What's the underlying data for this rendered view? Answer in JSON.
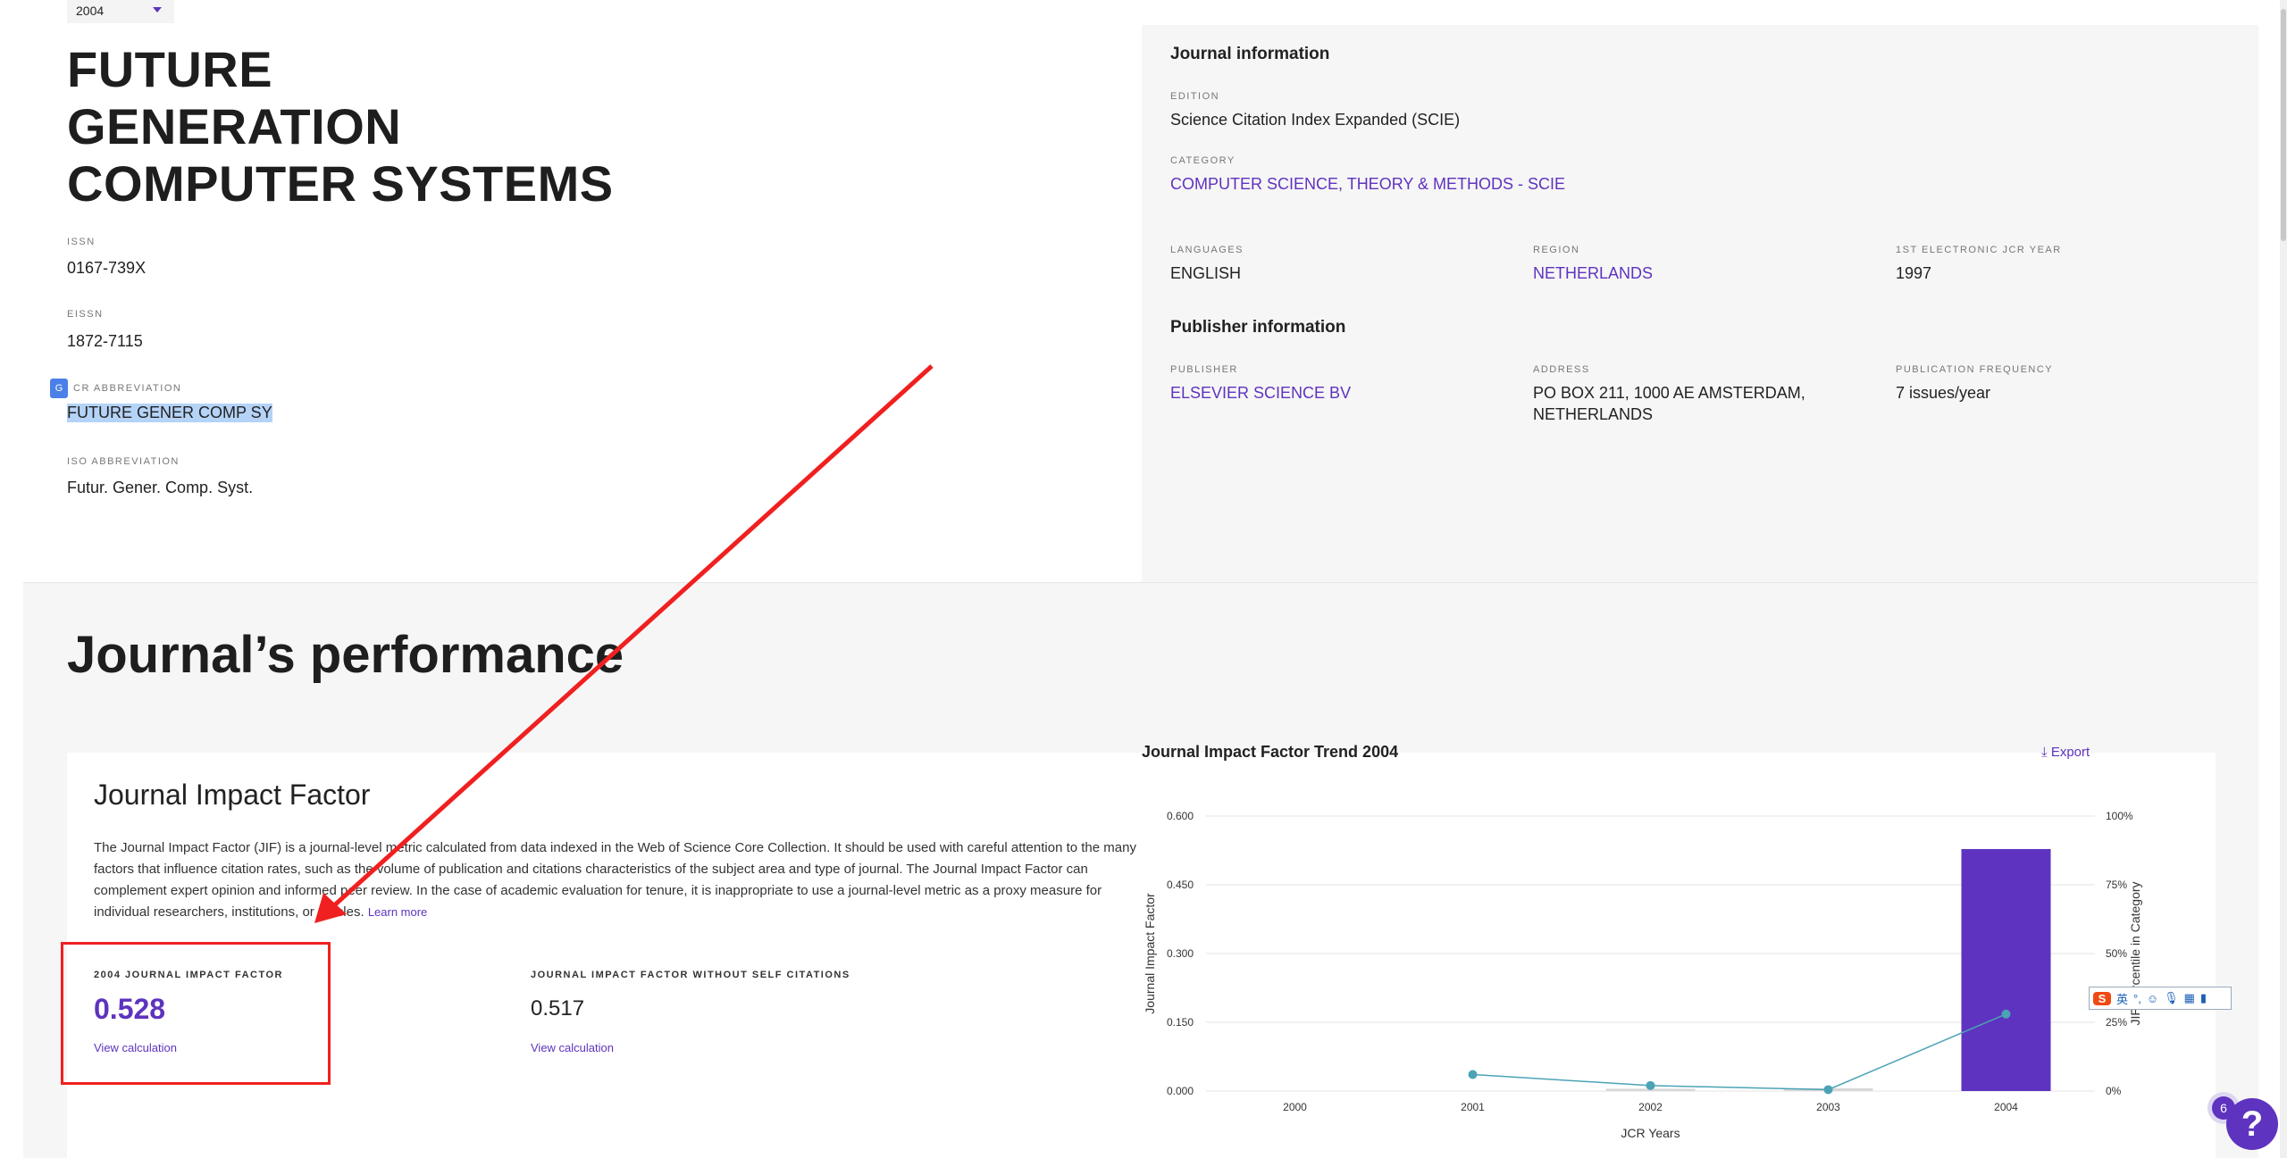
{
  "year_select": {
    "value": "2004"
  },
  "journal": {
    "title_lines": [
      "FUTURE",
      "GENERATION",
      "COMPUTER SYSTEMS"
    ],
    "issn_label": "ISSN",
    "issn": "0167-739X",
    "eissn_label": "EISSN",
    "eissn": "1872-7115",
    "jcr_abbrev_label": "CR ABBREVIATION",
    "jcr_abbrev": "FUTURE GENER COMP SY",
    "iso_abbrev_label": "ISO ABBREVIATION",
    "iso_abbrev": "Futur. Gener. Comp. Syst."
  },
  "journal_info": {
    "heading": "Journal information",
    "edition_label": "EDITION",
    "edition": "Science Citation Index Expanded (SCIE)",
    "category_label": "CATEGORY",
    "category": "COMPUTER SCIENCE, THEORY & METHODS - SCIE",
    "languages_label": "LANGUAGES",
    "languages": "ENGLISH",
    "region_label": "REGION",
    "region": "NETHERLANDS",
    "first_year_label": "1ST ELECTRONIC JCR YEAR",
    "first_year": "1997"
  },
  "publisher_info": {
    "heading": "Publisher information",
    "publisher_label": "PUBLISHER",
    "publisher": "ELSEVIER SCIENCE BV",
    "address_label": "ADDRESS",
    "address_line1": "PO BOX 211, 1000 AE AMSTERDAM,",
    "address_line2": "NETHERLANDS",
    "frequency_label": "PUBLICATION FREQUENCY",
    "frequency": "7 issues/year"
  },
  "performance": {
    "heading": "Journal’s performance",
    "jif_heading": "Journal Impact Factor",
    "description": "The Journal Impact Factor (JIF) is a journal-level metric calculated from data indexed in the Web of Science Core Collection. It should be used with careful attention to the many factors that influence citation rates, such as the volume of publication and citations characteristics of the subject area and type of journal. The Journal Impact Factor can complement expert opinion and informed peer review. In the case of academic evaluation for tenure, it is inappropriate to use a journal-level metric as a proxy measure for individual researchers, institutions, or articles.",
    "learn_more": "Learn more",
    "jif_label": "2004 JOURNAL IMPACT FACTOR",
    "jif_value": "0.528",
    "jif_noself_label": "JOURNAL IMPACT FACTOR WITHOUT SELF CITATIONS",
    "jif_noself_value": "0.517",
    "view_calc": "View calculation",
    "export": "Export"
  },
  "chart_data": {
    "type": "bar",
    "title": "Journal Impact Factor Trend 2004",
    "xlabel": "JCR Years",
    "ylabel": "Journal Impact Factor",
    "ylabel_right": "JIF Percentile in Category",
    "categories": [
      "2000",
      "2001",
      "2002",
      "2003",
      "2004"
    ],
    "ylim": [
      0,
      0.6
    ],
    "yticks": [
      "0.000",
      "0.150",
      "0.300",
      "0.450",
      "0.600"
    ],
    "yticks_right": [
      "0%",
      "25%",
      "50%",
      "75%",
      "100%"
    ],
    "series": [
      {
        "type": "bar",
        "values": [
          null,
          null,
          0.005,
          0.006,
          0.528
        ],
        "colors": [
          "#d8d8d8",
          "#d8d8d8",
          "#d8d8d8",
          "#d8d8d8",
          "#5e33bf"
        ]
      },
      {
        "type": "line",
        "axis": "right",
        "values": [
          null,
          6,
          2,
          0.5,
          28
        ],
        "color": "#4ba3b5"
      }
    ],
    "grid": true
  },
  "widgets": {
    "help": "?",
    "help_badge": "6",
    "ime_lang": "英"
  },
  "colors": {
    "accent": "#5e33bf",
    "annotation": "#f02020"
  }
}
